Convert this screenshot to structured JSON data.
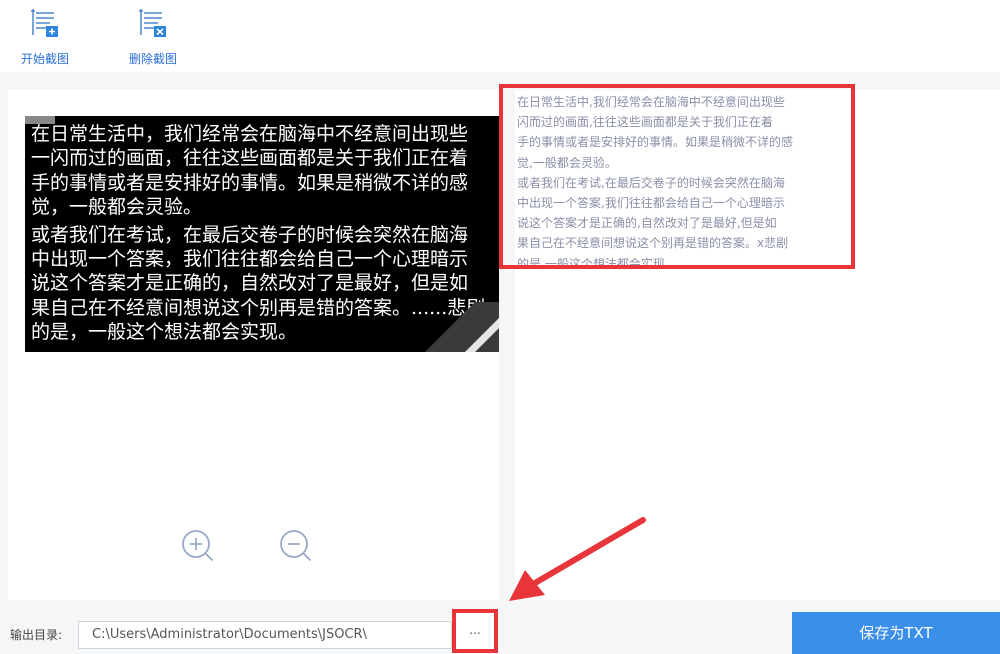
{
  "toolbar": {
    "start_label": "开始截图",
    "delete_label": "删除截图",
    "start_icon": "screenshot-add-icon",
    "delete_icon": "screenshot-delete-icon"
  },
  "image_panel": {
    "paragraphs": [
      [
        "在日常生活中，我们经常会在脑海中不经意间出现些",
        "一闪而过的画面，往往这些画面都是关于我们正在着",
        "手的事情或者是安排好的事情。如果是稍微不详的感",
        "觉，一般都会灵验。"
      ],
      [
        "或者我们在考试，在最后交卷子的时候会突然在脑海",
        "中出现一个答案，我们往往都会给自己一个心理暗示",
        "说这个答案才是正确的，自然改对了是最好，但是如",
        "果自己在不经意间想说这个别再是错的答案。......悲剧",
        "的是，一般这个想法都会实现。"
      ]
    ],
    "zoom_in_icon": "zoom-in-icon",
    "zoom_out_icon": "zoom-out-icon"
  },
  "result_panel": {
    "lines": [
      "在日常生活中,我们经常会在脑海中不经意间出现些",
      "闪而过的画面,往往这些画面都是关于我们正在着",
      "手的事情或者是安排好的事情。如果是稍微不详的感",
      "觉,一般都会灵验。",
      "或者我们在考试,在最后交卷子的时候会突然在脑海",
      "中出现一个答案,我们往往都会给自己一个心理暗示",
      "说这个答案才是正确的,自然改对了是最好,但是如",
      "果自己在不经意间想说这个别再是错的答案。x悲剧",
      "的是,一般这个想法都会实现。"
    ]
  },
  "bottom": {
    "output_label": "输出目录:",
    "output_path": "C:\\Users\\Administrator\\Documents\\JSOCR\\",
    "browse_label": "...",
    "save_label": "保存为TXT"
  },
  "colors": {
    "accent": "#3b8fe8",
    "annotation_red": "#e8353a",
    "result_text": "#8b8fa8"
  }
}
